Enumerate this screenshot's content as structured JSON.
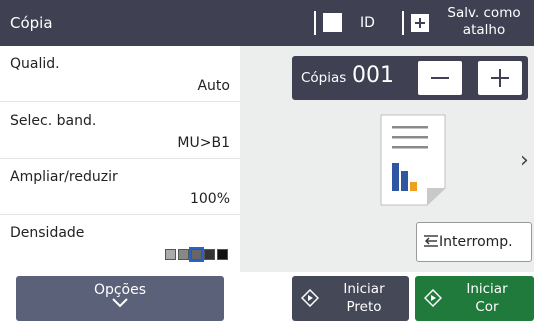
{
  "header": {
    "title": "Cópia",
    "id_copy_label": "ID",
    "shortcut_line1": "Salv. como",
    "shortcut_line2": "atalho"
  },
  "settings": [
    {
      "label": "Qualid.",
      "value": "Auto"
    },
    {
      "label": "Selec. band.",
      "value": "MU>B1"
    },
    {
      "label": "Ampliar/reduzir",
      "value": "100%"
    },
    {
      "label": "Densidade",
      "level": 3,
      "levels": 5
    }
  ],
  "copies": {
    "label": "Cópias",
    "count": "001"
  },
  "interrupt_label": "Interromp.",
  "bottom": {
    "options_label": "Opções",
    "start_black_line1": "Iniciar",
    "start_black_line2": "Preto",
    "start_color_line1": "Iniciar",
    "start_color_line2": "Cor"
  },
  "colors": {
    "header_bg": "#3f4152",
    "options_bg": "#5a6179",
    "start_black_bg": "#444857",
    "start_color_bg": "#1f7a3b",
    "accent_blue": "#2a62c9",
    "preview_orange": "#f0a020"
  },
  "icons": [
    "checkbox-icon",
    "plus-icon",
    "minus-icon",
    "next-arrow-icon",
    "interrupt-icon",
    "chevron-down-icon",
    "start-diamond-icon",
    "document-preview-icon"
  ]
}
